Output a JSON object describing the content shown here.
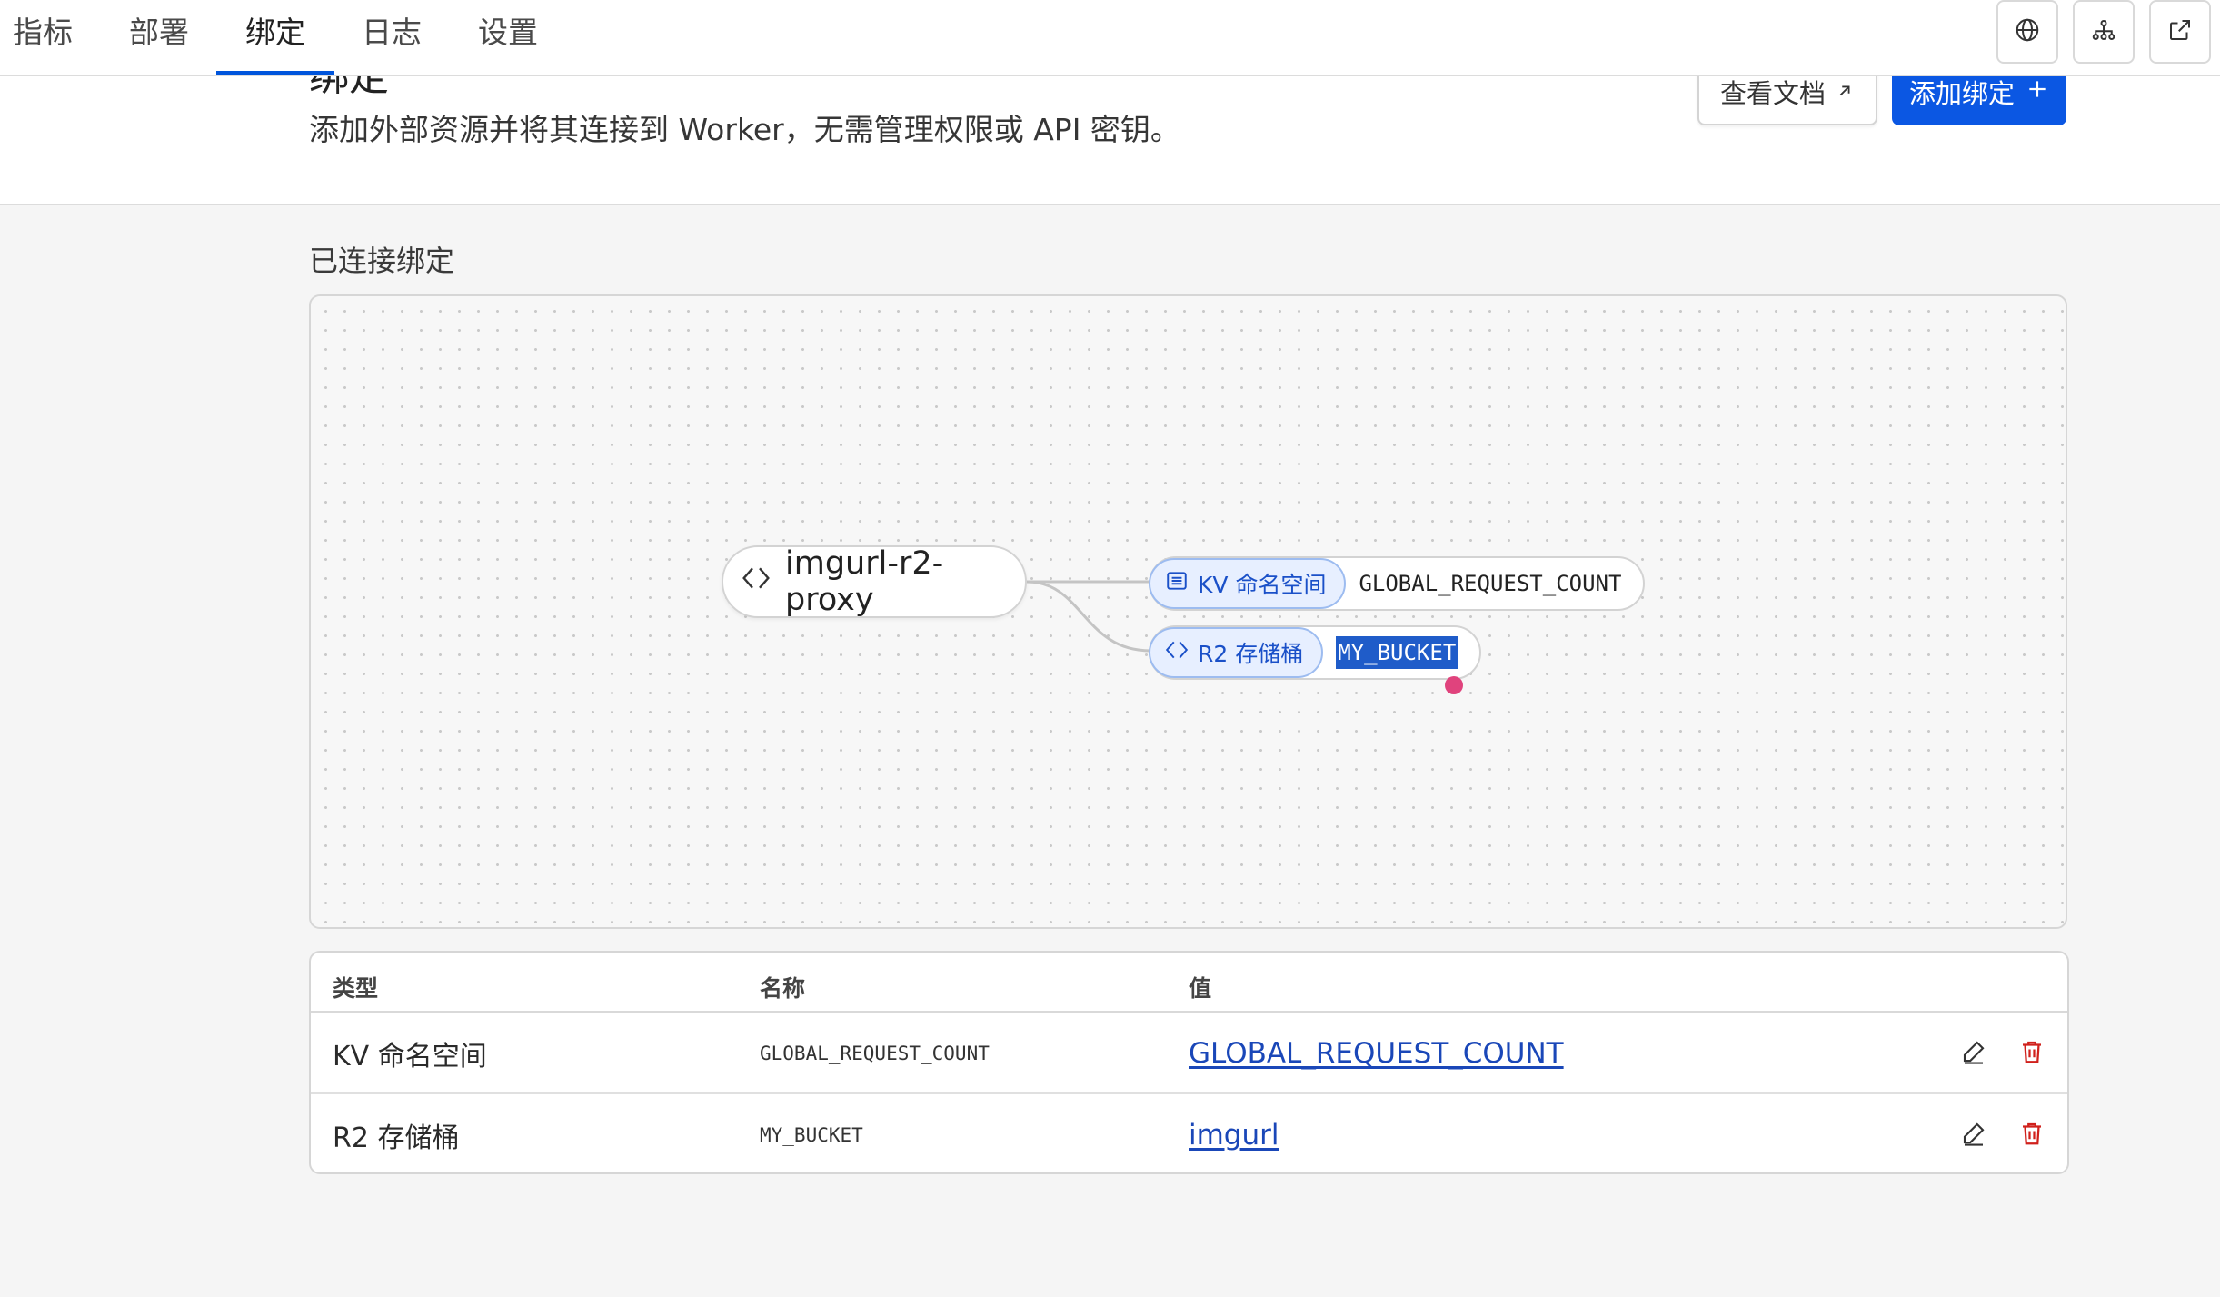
{
  "tabs": [
    {
      "label": "指标"
    },
    {
      "label": "部署"
    },
    {
      "label": "绑定",
      "active": true
    },
    {
      "label": "日志"
    },
    {
      "label": "设置"
    }
  ],
  "header": {
    "title_peek": "绑定",
    "subtitle": "添加外部资源并将其连接到 Worker，无需管理权限或 API 密钥。",
    "docs_button": "查看文档",
    "add_button": "添加绑定"
  },
  "section_title": "已连接绑定",
  "graph": {
    "worker_name": "imgurl-r2-proxy",
    "bindings": [
      {
        "type_label": "KV 命名空间",
        "name": "GLOBAL_REQUEST_COUNT",
        "icon": "list-icon"
      },
      {
        "type_label": "R2 存储桶",
        "name": "MY_BUCKET",
        "icon": "diamond-icon",
        "selected": true
      }
    ]
  },
  "table": {
    "headers": [
      "类型",
      "名称",
      "值"
    ],
    "rows": [
      {
        "type": "KV 命名空间",
        "name": "GLOBAL_REQUEST_COUNT",
        "value": "GLOBAL_REQUEST_COUNT"
      },
      {
        "type": "R2 存储桶",
        "name": "MY_BUCKET",
        "value": "imgurl"
      }
    ]
  },
  "colors": {
    "accent": "#0b57e3",
    "link": "#1a47b8",
    "delete": "#d0211c",
    "tag_bg": "#e7efff",
    "handle": "#e0437d"
  }
}
